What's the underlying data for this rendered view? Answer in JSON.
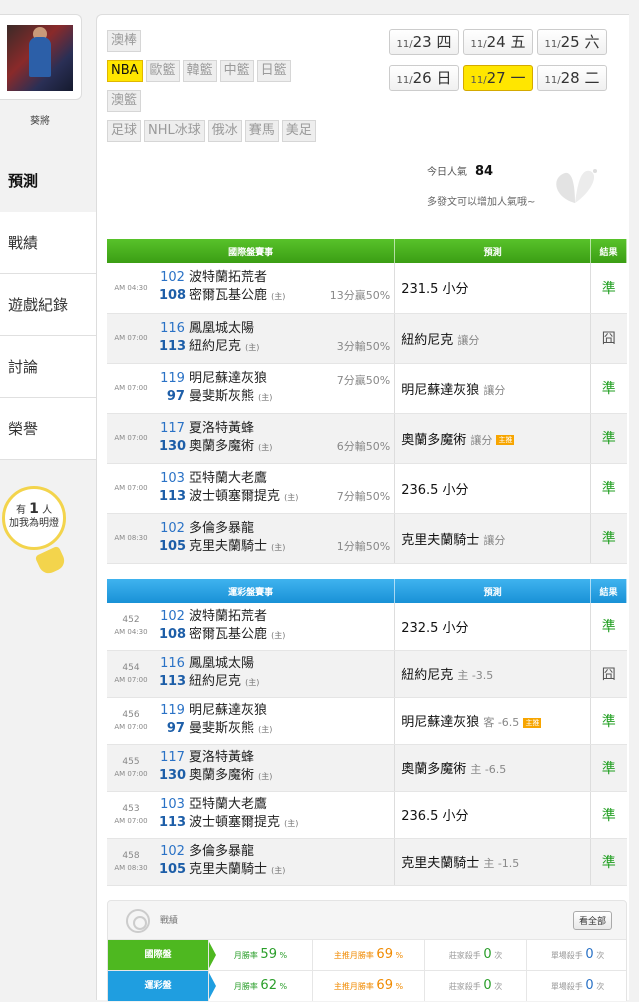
{
  "user": {
    "name": "葵將"
  },
  "nav": [
    {
      "label": "預測",
      "active": true
    },
    {
      "label": "戰績"
    },
    {
      "label": "遊戲紀錄"
    },
    {
      "label": "討論"
    },
    {
      "label": "榮譽"
    }
  ],
  "bulb": {
    "prefix": "有",
    "count": "1",
    "unit": "人",
    "text": "加我為明燈"
  },
  "leagues": [
    [
      "澳棒"
    ],
    [
      "NBA",
      "歐籃",
      "韓籃",
      "中籃",
      "日籃"
    ],
    [
      "澳籃"
    ],
    [
      "足球",
      "NHL冰球",
      "俄冰",
      "賽馬",
      "美足"
    ]
  ],
  "active_league": "NBA",
  "dates": [
    [
      {
        "md": "11/",
        "d": "23",
        "w": "四"
      },
      {
        "md": "11/",
        "d": "24",
        "w": "五"
      },
      {
        "md": "11/",
        "d": "25",
        "w": "六"
      }
    ],
    [
      {
        "md": "11/",
        "d": "26",
        "w": "日"
      },
      {
        "md": "11/",
        "d": "27",
        "w": "一",
        "on": true
      },
      {
        "md": "11/",
        "d": "28",
        "w": "二"
      }
    ]
  ],
  "popularity": {
    "label": "今日人氣",
    "value": "84",
    "hint": "多發文可以增加人氣哦~"
  },
  "intl": {
    "header": {
      "match": "國際盤賽事",
      "pick": "預測",
      "result": "結果"
    },
    "rows": [
      {
        "time": "AM 04:30",
        "away_no": "102",
        "away": "波特蘭拓荒者",
        "home_no": "108",
        "home": "密爾瓦基公鹿",
        "home_tag": "(主)",
        "odds": "13分贏50%",
        "odds_row": 2,
        "pick": "231.5 小分",
        "result": "準",
        "ok": true
      },
      {
        "time": "AM 07:00",
        "away_no": "116",
        "away": "鳳凰城太陽",
        "home_no": "113",
        "home": "紐約尼克",
        "home_tag": "(主)",
        "odds": "3分輸50%",
        "odds_row": 2,
        "pick": "紐約尼克",
        "pick_sub": "讓分",
        "result": "囧",
        "ok": false
      },
      {
        "time": "AM 07:00",
        "away_no": "119",
        "away": "明尼蘇達灰狼",
        "home_no": "97",
        "home": "曼斐斯灰熊",
        "home_tag": "(主)",
        "odds": "7分贏50%",
        "odds_row": 1,
        "pick": "明尼蘇達灰狼",
        "pick_sub": "讓分",
        "result": "準",
        "ok": true
      },
      {
        "time": "AM 07:00",
        "away_no": "117",
        "away": "夏洛特黃蜂",
        "home_no": "130",
        "home": "奧蘭多魔術",
        "home_tag": "(主)",
        "odds": "6分輸50%",
        "odds_row": 2,
        "pick": "奧蘭多魔術",
        "pick_sub": "讓分",
        "tag": "主推",
        "result": "準",
        "ok": true
      },
      {
        "time": "AM 07:00",
        "away_no": "103",
        "away": "亞特蘭大老鷹",
        "home_no": "113",
        "home": "波士頓塞爾提克",
        "home_tag": "(主)",
        "odds": "7分輸50%",
        "odds_row": 2,
        "pick": "236.5 小分",
        "result": "準",
        "ok": true
      },
      {
        "time": "AM 08:30",
        "away_no": "102",
        "away": "多倫多暴龍",
        "home_no": "105",
        "home": "克里夫蘭騎士",
        "home_tag": "(主)",
        "odds": "1分輸50%",
        "odds_row": 2,
        "pick": "克里夫蘭騎士",
        "pick_sub": "讓分",
        "result": "準",
        "ok": true
      }
    ]
  },
  "lottery": {
    "header": {
      "match": "運彩盤賽事",
      "pick": "預測",
      "result": "結果"
    },
    "rows": [
      {
        "no": "452",
        "time": "AM 04:30",
        "away_no": "102",
        "away": "波特蘭拓荒者",
        "home_no": "108",
        "home": "密爾瓦基公鹿",
        "home_tag": "(主)",
        "pick": "232.5 小分",
        "result": "準",
        "ok": true
      },
      {
        "no": "454",
        "time": "AM 07:00",
        "away_no": "116",
        "away": "鳳凰城太陽",
        "home_no": "113",
        "home": "紐約尼克",
        "home_tag": "(主)",
        "pick": "紐約尼克",
        "pick_sub": "主 -3.5",
        "result": "囧",
        "ok": false
      },
      {
        "no": "456",
        "time": "AM 07:00",
        "away_no": "119",
        "away": "明尼蘇達灰狼",
        "home_no": "97",
        "home": "曼斐斯灰熊",
        "home_tag": "(主)",
        "pick": "明尼蘇達灰狼",
        "pick_sub": "客 -6.5",
        "tag": "主推",
        "result": "準",
        "ok": true
      },
      {
        "no": "455",
        "time": "AM 07:00",
        "away_no": "117",
        "away": "夏洛特黃蜂",
        "home_no": "130",
        "home": "奧蘭多魔術",
        "home_tag": "(主)",
        "pick": "奧蘭多魔術",
        "pick_sub": "主 -6.5",
        "result": "準",
        "ok": true
      },
      {
        "no": "453",
        "time": "AM 07:00",
        "away_no": "103",
        "away": "亞特蘭大老鷹",
        "home_no": "113",
        "home": "波士頓塞爾提克",
        "home_tag": "(主)",
        "pick": "236.5 小分",
        "result": "準",
        "ok": true
      },
      {
        "no": "458",
        "time": "AM 08:30",
        "away_no": "102",
        "away": "多倫多暴龍",
        "home_no": "105",
        "home": "克里夫蘭騎士",
        "home_tag": "(主)",
        "pick": "克里夫蘭騎士",
        "pick_sub": "主 -1.5",
        "result": "準",
        "ok": true
      }
    ]
  },
  "stats": {
    "title": "戰績",
    "all_btn": "看全部",
    "rows": [
      {
        "label": "國際盤",
        "cls": "g",
        "month_label": "月勝率",
        "month": "59",
        "main_label": "主推月勝率",
        "main": "69",
        "house_label": "莊家殺手",
        "house": "0",
        "single_label": "單場殺手",
        "single": "0",
        "pct": "%",
        "times": "次"
      },
      {
        "label": "運彩盤",
        "cls": "b",
        "month_label": "月勝率",
        "month": "62",
        "main_label": "主推月勝率",
        "main": "69",
        "house_label": "莊家殺手",
        "house": "0",
        "single_label": "單場殺手",
        "single": "0",
        "pct": "%",
        "times": "次"
      }
    ]
  }
}
